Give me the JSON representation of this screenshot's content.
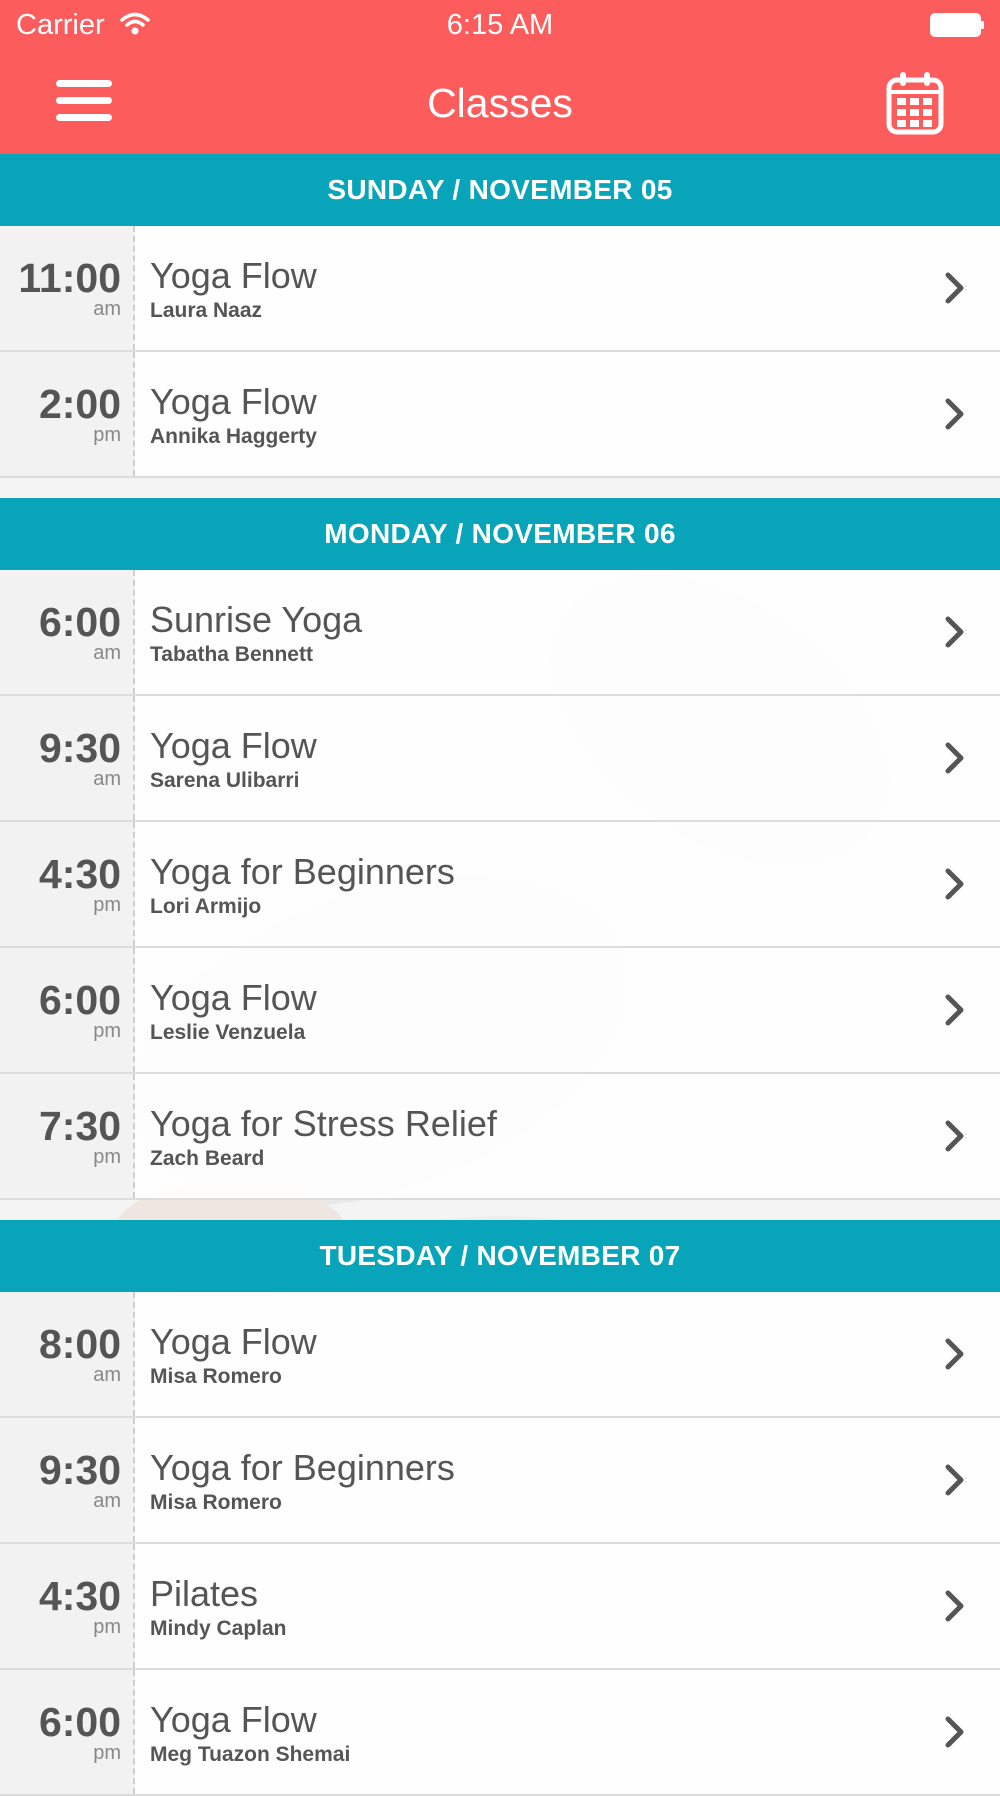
{
  "status_bar": {
    "carrier": "Carrier",
    "time": "6:15 AM"
  },
  "nav": {
    "title": "Classes",
    "menu_icon": "hamburger-menu-icon",
    "calendar_icon": "calendar-icon"
  },
  "colors": {
    "header": "#fc5c5c",
    "section": "#07a4ba",
    "text": "#555555"
  },
  "days": [
    {
      "header": "SUNDAY / NOVEMBER 05",
      "classes": [
        {
          "time": "11:00",
          "ampm": "am",
          "title": "Yoga Flow",
          "instructor": "Laura Naaz"
        },
        {
          "time": "2:00",
          "ampm": "pm",
          "title": "Yoga Flow",
          "instructor": "Annika Haggerty"
        }
      ]
    },
    {
      "header": "MONDAY / NOVEMBER 06",
      "classes": [
        {
          "time": "6:00",
          "ampm": "am",
          "title": "Sunrise Yoga",
          "instructor": "Tabatha Bennett"
        },
        {
          "time": "9:30",
          "ampm": "am",
          "title": "Yoga Flow",
          "instructor": "Sarena Ulibarri"
        },
        {
          "time": "4:30",
          "ampm": "pm",
          "title": "Yoga for Beginners",
          "instructor": "Lori Armijo"
        },
        {
          "time": "6:00",
          "ampm": "pm",
          "title": "Yoga Flow",
          "instructor": "Leslie Venzuela"
        },
        {
          "time": "7:30",
          "ampm": "pm",
          "title": "Yoga for Stress Relief",
          "instructor": "Zach Beard"
        }
      ]
    },
    {
      "header": "TUESDAY / NOVEMBER 07",
      "classes": [
        {
          "time": "8:00",
          "ampm": "am",
          "title": "Yoga Flow",
          "instructor": "Misa Romero"
        },
        {
          "time": "9:30",
          "ampm": "am",
          "title": "Yoga for Beginners",
          "instructor": "Misa Romero"
        },
        {
          "time": "4:30",
          "ampm": "pm",
          "title": "Pilates",
          "instructor": "Mindy Caplan"
        },
        {
          "time": "6:00",
          "ampm": "pm",
          "title": "Yoga Flow",
          "instructor": "Meg Tuazon Shemai"
        }
      ]
    }
  ]
}
